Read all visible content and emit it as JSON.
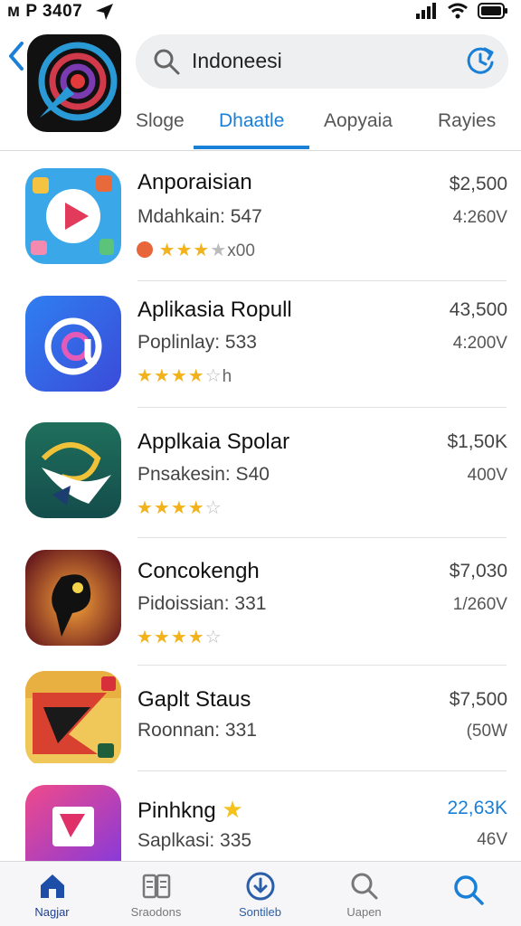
{
  "status_bar": {
    "time": "ᴍ P 3407",
    "icons": [
      "navigation-arrow-icon",
      "signal-icon",
      "wifi-icon",
      "battery-icon"
    ]
  },
  "header": {
    "back_icon": "chevron-left-icon",
    "search_value": "Indoneesi",
    "refresh_icon": "refresh-icon"
  },
  "tabs": [
    {
      "label": "Sloge"
    },
    {
      "label": "Dhaatle"
    },
    {
      "label": "Aopyaia"
    },
    {
      "label": "Rayies"
    }
  ],
  "active_tab": 1,
  "apps": [
    {
      "title": "Anporaisian",
      "subtitle": "Mdahkain: 547",
      "stars_filled": "★★★",
      "stars_empty": "★",
      "rating_text": "x00",
      "price": "$2,500",
      "size": "4:260V"
    },
    {
      "title": "Aplikasia Ropull",
      "subtitle": "Poplinlay: 533",
      "stars_filled": "★★★★",
      "stars_empty": "☆",
      "rating_text": "h",
      "price": "43,500",
      "size": "4:200V"
    },
    {
      "title": "Applkaia Spolar",
      "subtitle": "Pnsakesin: S40",
      "stars_filled": "★★★★",
      "stars_empty": "☆",
      "rating_text": "",
      "price": "$1,50K",
      "size": "400V"
    },
    {
      "title": "Concokengh",
      "subtitle": "Pidoissian: 331",
      "stars_filled": "★★★★",
      "stars_empty": "☆",
      "rating_text": "",
      "price": "$7,030",
      "size": "1/260V"
    },
    {
      "title": "Gaplt Staus",
      "subtitle": "Roonnan: 331",
      "price": "$7,500",
      "size": "(50W"
    },
    {
      "title": "Pinhkng",
      "subtitle": "Saplkasi: 335",
      "price": "22,63K",
      "size": "46V"
    }
  ],
  "bottom_nav": [
    {
      "label": "Nagjar",
      "icon": "home-icon"
    },
    {
      "label": "Sraodons",
      "icon": "book-icon"
    },
    {
      "label": "Sontileb",
      "icon": "download-icon"
    },
    {
      "label": "Uapen",
      "icon": "search-icon"
    },
    {
      "label": "",
      "icon": "search-icon"
    }
  ],
  "colors": {
    "accent": "#1a7fd6",
    "star": "#f2b21b",
    "nav_active": "#1d3f8f"
  }
}
